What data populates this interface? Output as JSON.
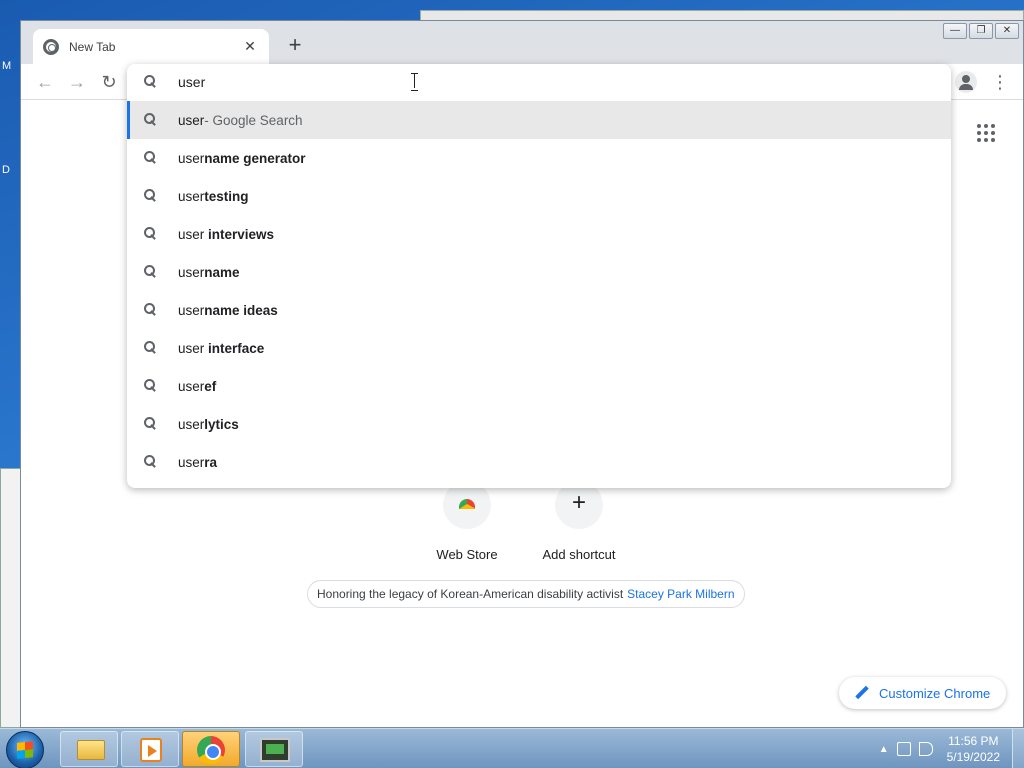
{
  "window": {
    "tab_title": "New Tab",
    "tab_close": "✕",
    "new_tab": "+",
    "controls": [
      "—",
      "❐",
      "✕"
    ]
  },
  "toolbar": {
    "back": "←",
    "forward": "→",
    "reload": "↻",
    "menu": "⋮"
  },
  "omnibox": {
    "query": "user",
    "suggestions": [
      {
        "prefix": "user",
        "bold": "",
        "suffix": " - Google Search",
        "selected": true
      },
      {
        "prefix": "user",
        "bold": "name generator",
        "suffix": ""
      },
      {
        "prefix": "user",
        "bold": "testing",
        "suffix": ""
      },
      {
        "prefix": "user ",
        "bold": "interviews",
        "suffix": ""
      },
      {
        "prefix": "user",
        "bold": "name",
        "suffix": ""
      },
      {
        "prefix": "user",
        "bold": "name ideas",
        "suffix": ""
      },
      {
        "prefix": "user ",
        "bold": "interface",
        "suffix": ""
      },
      {
        "prefix": "user",
        "bold": "ef",
        "suffix": ""
      },
      {
        "prefix": "user",
        "bold": "lytics",
        "suffix": ""
      },
      {
        "prefix": "user",
        "bold": "ra",
        "suffix": ""
      }
    ]
  },
  "ntp": {
    "shortcuts": [
      {
        "label": "Web Store"
      },
      {
        "label": "Add shortcut",
        "glyph": "+"
      }
    ],
    "doodle_text": "Honoring the legacy of Korean-American disability activist",
    "doodle_link": "Stacey Park Milbern",
    "customize": "Customize Chrome"
  },
  "desktop": {
    "letters": [
      "M",
      "D"
    ]
  },
  "taskbar": {
    "tray_arrow": "▲",
    "time": "11:56 PM",
    "date": "5/19/2022"
  },
  "colors": {
    "accent": "#1a73e8",
    "selected_row": "#e8e8e8"
  }
}
